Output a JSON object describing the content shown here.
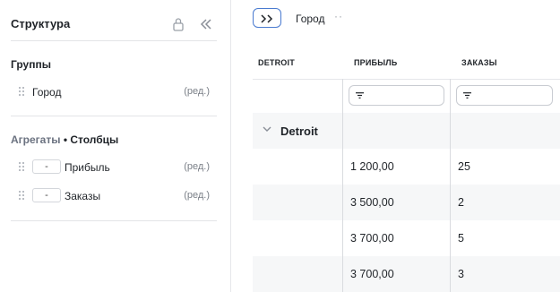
{
  "sidebar": {
    "title": "Структура",
    "groups_title": "Группы",
    "groups": [
      {
        "label": "Город",
        "edit": "(ред.)"
      }
    ],
    "aggregates_title": "Агрегаты",
    "aggregates_separator": "•",
    "columns_title": "Столбцы",
    "aggregates": [
      {
        "agg": "-",
        "label": "Прибыль",
        "edit": "(ред.)"
      },
      {
        "agg": "-",
        "label": "Заказы",
        "edit": "(ред.)"
      }
    ]
  },
  "toolbar": {
    "breadcrumb": "Город",
    "breadcrumb_more": "··"
  },
  "table": {
    "columns": [
      "DETROIT",
      "ПРИБЫЛЬ",
      "ЗАКАЗЫ"
    ],
    "group_label": "Detroit",
    "rows": [
      {
        "profit": "1 200,00",
        "orders": "25"
      },
      {
        "profit": "3 500,00",
        "orders": "2"
      },
      {
        "profit": "3 700,00",
        "orders": "5"
      },
      {
        "profit": "3 700,00",
        "orders": "3"
      }
    ]
  },
  "colors": {
    "accent": "#4a7bd0",
    "row_alt": "#f6f7f8",
    "border": "#e6e7ea",
    "muted_text": "#7b8088"
  }
}
